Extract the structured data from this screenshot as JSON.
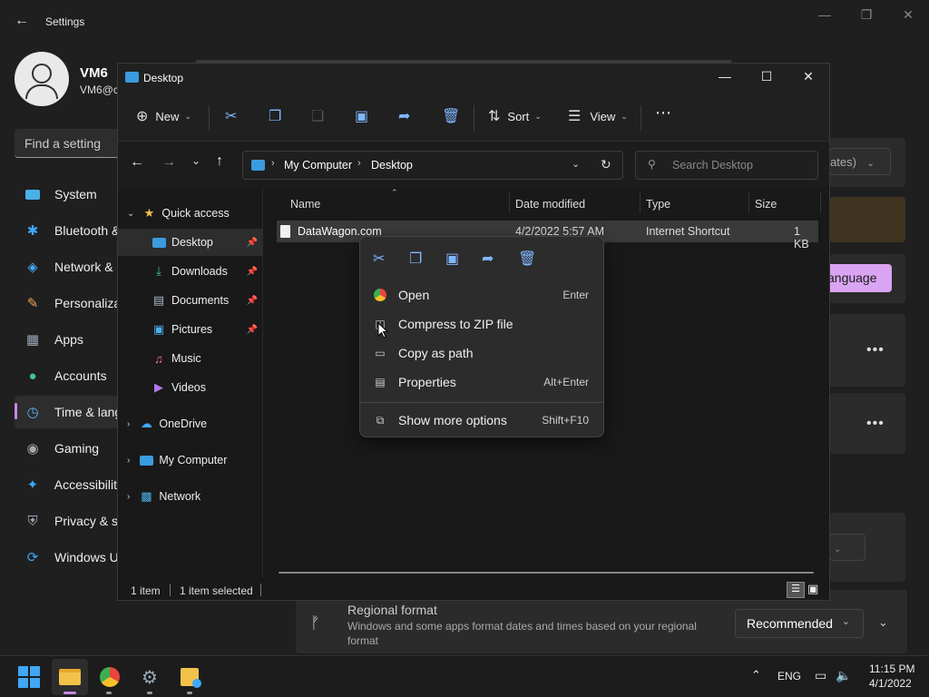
{
  "settings": {
    "title": "Settings",
    "user": {
      "name": "VM6",
      "email": "VM6@c"
    },
    "search_placeholder": "Find a setting",
    "nav": [
      {
        "label": "System",
        "icon": "monitor-icon"
      },
      {
        "label": "Bluetooth &",
        "icon": "bluetooth-icon"
      },
      {
        "label": "Network &",
        "icon": "wifi-icon"
      },
      {
        "label": "Personaliza",
        "icon": "brush-icon"
      },
      {
        "label": "Apps",
        "icon": "apps-icon"
      },
      {
        "label": "Accounts",
        "icon": "person-icon"
      },
      {
        "label": "Time & lang",
        "icon": "clock-icon",
        "selected": true
      },
      {
        "label": "Gaming",
        "icon": "gamepad-icon"
      },
      {
        "label": "Accessibility",
        "icon": "accessibility-icon"
      },
      {
        "label": "Privacy & s",
        "icon": "shield-icon"
      },
      {
        "label": "Windows U",
        "icon": "update-icon"
      }
    ],
    "updates_fragment": "ates)",
    "language_button": "anguage",
    "region_card": {
      "title": "Regional format",
      "description": "Windows and some apps format dates and times based on your regional format",
      "dropdown_value": "Recommended"
    }
  },
  "explorer": {
    "title": "Desktop",
    "toolbar": {
      "new_label": "New",
      "sort_label": "Sort",
      "view_label": "View"
    },
    "breadcrumb": [
      "My Computer",
      "Desktop"
    ],
    "search_placeholder": "Search Desktop",
    "nav_pane": [
      {
        "label": "Quick access",
        "icon": "star-icon",
        "expanded": true
      },
      {
        "label": "Desktop",
        "icon": "desktop-icon",
        "pinned": true,
        "selected": true
      },
      {
        "label": "Downloads",
        "icon": "download-icon",
        "pinned": true
      },
      {
        "label": "Documents",
        "icon": "document-icon",
        "pinned": true
      },
      {
        "label": "Pictures",
        "icon": "picture-icon",
        "pinned": true
      },
      {
        "label": "Music",
        "icon": "music-icon"
      },
      {
        "label": "Videos",
        "icon": "video-icon"
      },
      {
        "label": "OneDrive",
        "icon": "cloud-icon"
      },
      {
        "label": "My Computer",
        "icon": "computer-icon"
      },
      {
        "label": "Network",
        "icon": "network-icon"
      }
    ],
    "columns": [
      "Name",
      "Date modified",
      "Type",
      "Size"
    ],
    "files": [
      {
        "name": "DataWagon.com",
        "date": "4/2/2022 5:57 AM",
        "type": "Internet Shortcut",
        "size": "1 KB"
      }
    ],
    "status": {
      "count": "1 item",
      "selection": "1 item selected"
    }
  },
  "context_menu": {
    "items": [
      {
        "label": "Open",
        "shortcut": "Enter",
        "icon": "chrome-icon"
      },
      {
        "label": "Compress to ZIP file",
        "shortcut": "",
        "icon": "zip-icon"
      },
      {
        "label": "Copy as path",
        "shortcut": "",
        "icon": "copy-path-icon"
      },
      {
        "label": "Properties",
        "shortcut": "Alt+Enter",
        "icon": "properties-icon"
      },
      {
        "label": "Show more options",
        "shortcut": "Shift+F10",
        "icon": "more-options-icon"
      }
    ]
  },
  "taskbar": {
    "language": "ENG",
    "time": "11:15 PM",
    "date": "4/1/2022"
  },
  "colors": {
    "accent": "#c987e6",
    "explorer_icon": "#7fb7ff"
  }
}
